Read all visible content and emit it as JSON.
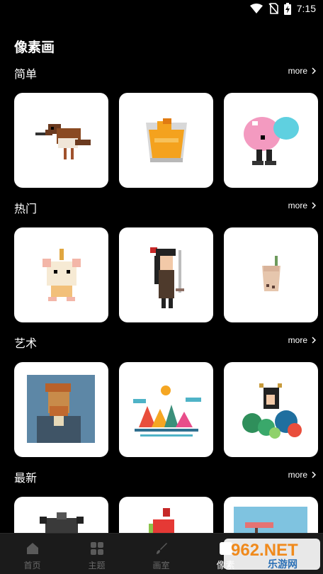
{
  "status": {
    "time": "7:15"
  },
  "page_title": "像素画",
  "more_label": "more",
  "sections": [
    {
      "title": "简单"
    },
    {
      "title": "热门"
    },
    {
      "title": "艺术"
    },
    {
      "title": "最新"
    }
  ],
  "tabs": [
    {
      "label": "首页"
    },
    {
      "label": "主题"
    },
    {
      "label": "画室"
    },
    {
      "label": "像素"
    }
  ],
  "watermark": {
    "brand": "962.NET",
    "sub": "乐游网"
  },
  "colors": {
    "background": "#000000",
    "card": "#ffffff",
    "tab_bar": "#1b1b1b",
    "tab_inactive": "#6a6a6a"
  }
}
